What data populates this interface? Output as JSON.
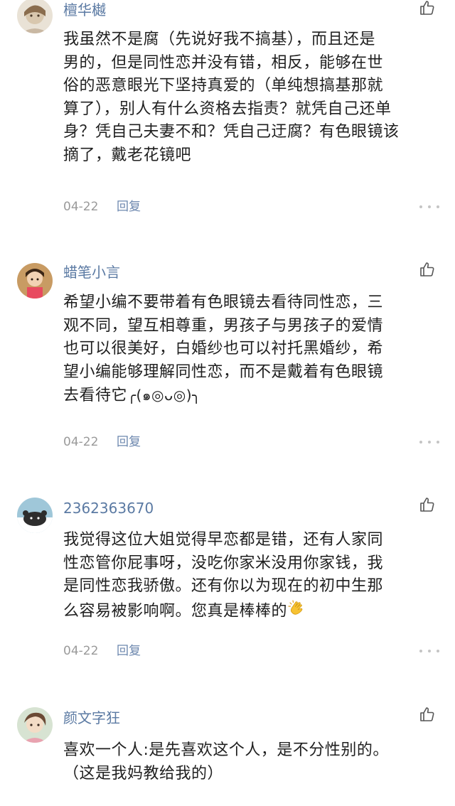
{
  "comments": [
    {
      "username": "檀华樾",
      "text_lines": [
        "我虽然不是腐（先说好我不搞基），而且还是",
        "男的，但是同性恋并没有错，相反，能够在世",
        "俗的恶意眼光下坚持真爱的（单纯想搞基那就",
        "算了），别人有什么资格去指责？就凭自己还单",
        "身？凭自己夫妻不和？凭自己迂腐？有色眼镜该",
        "摘了，戴老花镜吧"
      ],
      "date": "04-22",
      "reply_label": "回复",
      "like_icon": "thumbs-up-icon",
      "more_icon": "more-icon"
    },
    {
      "username": "蜡笔小言",
      "text_lines": [
        "希望小编不要带着有色眼镜去看待同性恋，三",
        "观不同，望互相尊重，男孩子与男孩子的爱情",
        "也可以很美好，白婚纱也可以衬托黑婚纱，希",
        "望小编能够理解同性恋，而不是戴着有色眼镜",
        "去看待它"
      ],
      "text_suffix_emoticon": "╭(๑◎ᴗ◎)╮",
      "date": "04-22",
      "reply_label": "回复",
      "like_icon": "thumbs-up-icon",
      "more_icon": "more-icon"
    },
    {
      "username": "2362363670",
      "text_lines": [
        "我觉得这位大姐觉得早恋都是错，还有人家同",
        "性恋管你屁事呀，没吃你家米没用你家钱，我",
        "是同性恋我骄傲。还有你以为现在的初中生那",
        "么容易被影响啊。您真是棒棒的"
      ],
      "text_suffix_emoji": "clapping-hand-emoji",
      "date": "04-22",
      "reply_label": "回复",
      "like_icon": "thumbs-up-icon",
      "more_icon": "more-icon"
    },
    {
      "username": "颜文字狂",
      "text_lines": [
        "喜欢一个人:是先喜欢这个人，是不分性别的。",
        "（这是我妈教给我的）"
      ],
      "like_icon": "thumbs-up-icon"
    }
  ],
  "colors": {
    "username": "#5b7aa3",
    "body_text": "#1f1f1f",
    "meta": "#9a9a9a",
    "reply": "#6c87ae",
    "icon": "#555555"
  }
}
